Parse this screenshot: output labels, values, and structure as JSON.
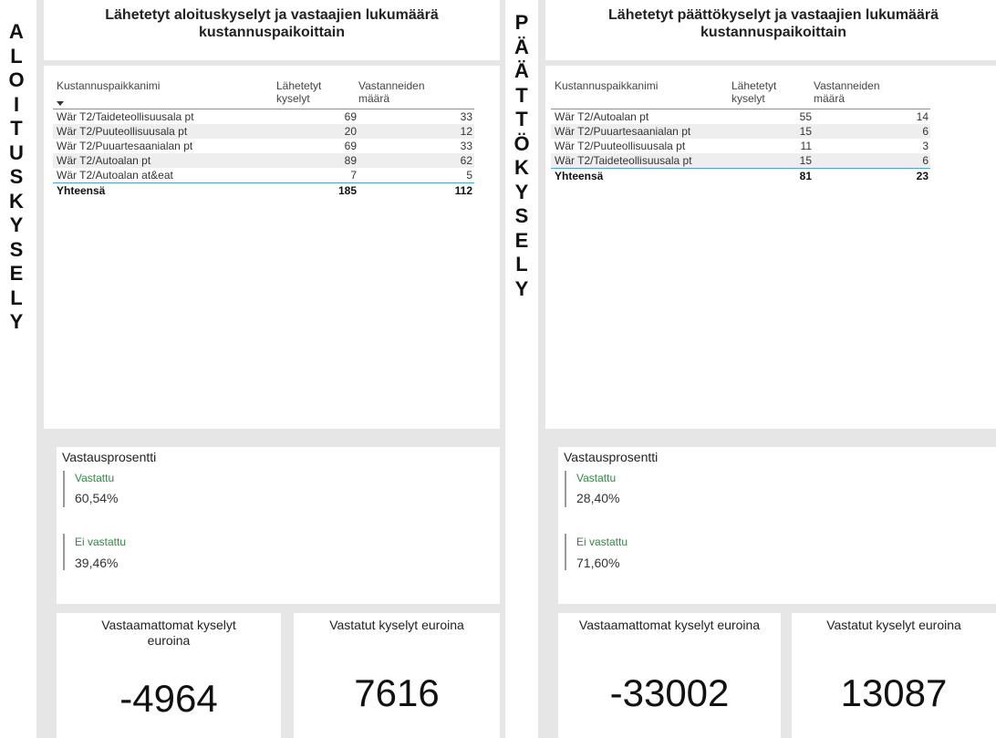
{
  "left": {
    "vertical_label": [
      "A",
      "L",
      "O",
      "I",
      "T",
      "U",
      "S",
      "K",
      "Y",
      "S",
      "E",
      "L",
      "Y"
    ],
    "title_line1": "Lähetetyt aloituskyselyt ja vastaajien lukumäärä",
    "title_line2": "kustannuspaikoittain",
    "table": {
      "col1": "Kustannuspaikkanimi",
      "col2_line1": "Lähetetyt",
      "col2_line2": "kyselyt",
      "col3_line1": "Vastanneiden",
      "col3_line2": "määrä",
      "rows": [
        {
          "name": "Wär T2/Taideteollisuusala pt",
          "sent": "69",
          "answered": "33"
        },
        {
          "name": "Wär T2/Puuteollisuusala pt",
          "sent": "20",
          "answered": "12"
        },
        {
          "name": "Wär T2/Puuartesaanialan pt",
          "sent": "69",
          "answered": "33"
        },
        {
          "name": "Wär T2/Autoalan pt",
          "sent": "89",
          "answered": "62"
        },
        {
          "name": "Wär T2/Autoalan at&eat",
          "sent": "7",
          "answered": "5"
        }
      ],
      "total_label": "Yhteensä",
      "total_sent": "185",
      "total_answered": "112"
    },
    "response": {
      "title": "Vastausprosentti",
      "answered_label": "Vastattu",
      "answered_value": "60,54%",
      "not_answered_label": "Ei vastattu",
      "not_answered_value": "39,46%"
    },
    "unanswered_eur": {
      "title_line1": "Vastaamattomat kyselyt",
      "title_line2": "euroina",
      "value": "-4964"
    },
    "answered_eur": {
      "title": "Vastatut kyselyt euroina",
      "value": "7616"
    }
  },
  "right": {
    "vertical_label": [
      "P",
      "Ä",
      "Ä",
      "T",
      "T",
      "Ö",
      "K",
      "Y",
      "S",
      "E",
      "L",
      "Y"
    ],
    "title_line1": "Lähetetyt päättökyselyt ja vastaajien lukumäärä",
    "title_line2": "kustannuspaikoittain",
    "table": {
      "col1": "Kustannuspaikkanimi",
      "col2_line1": "Lähetetyt",
      "col2_line2": "kyselyt",
      "col3_line1": "Vastanneiden",
      "col3_line2": "määrä",
      "rows": [
        {
          "name": "Wär T2/Autoalan pt",
          "sent": "55",
          "answered": "14"
        },
        {
          "name": "Wär T2/Puuartesaanialan pt",
          "sent": "15",
          "answered": "6"
        },
        {
          "name": "Wär T2/Puuteollisuusala pt",
          "sent": "11",
          "answered": "3"
        },
        {
          "name": "Wär T2/Taideteollisuusala pt",
          "sent": "15",
          "answered": "6"
        }
      ],
      "total_label": "Yhteensä",
      "total_sent": "81",
      "total_answered": "23"
    },
    "response": {
      "title": "Vastausprosentti",
      "answered_label": "Vastattu",
      "answered_value": "28,40%",
      "not_answered_label": "Ei vastattu",
      "not_answered_value": "71,60%"
    },
    "unanswered_eur": {
      "title": "Vastaamattomat kyselyt euroina",
      "value": "-33002"
    },
    "answered_eur": {
      "title": "Vastatut kyselyt euroina",
      "value": "13087"
    }
  },
  "colors": {
    "accent_line": "#4aa3df",
    "kpi_label": "#2e8b3d",
    "background_panel": "#e6e6e6"
  }
}
